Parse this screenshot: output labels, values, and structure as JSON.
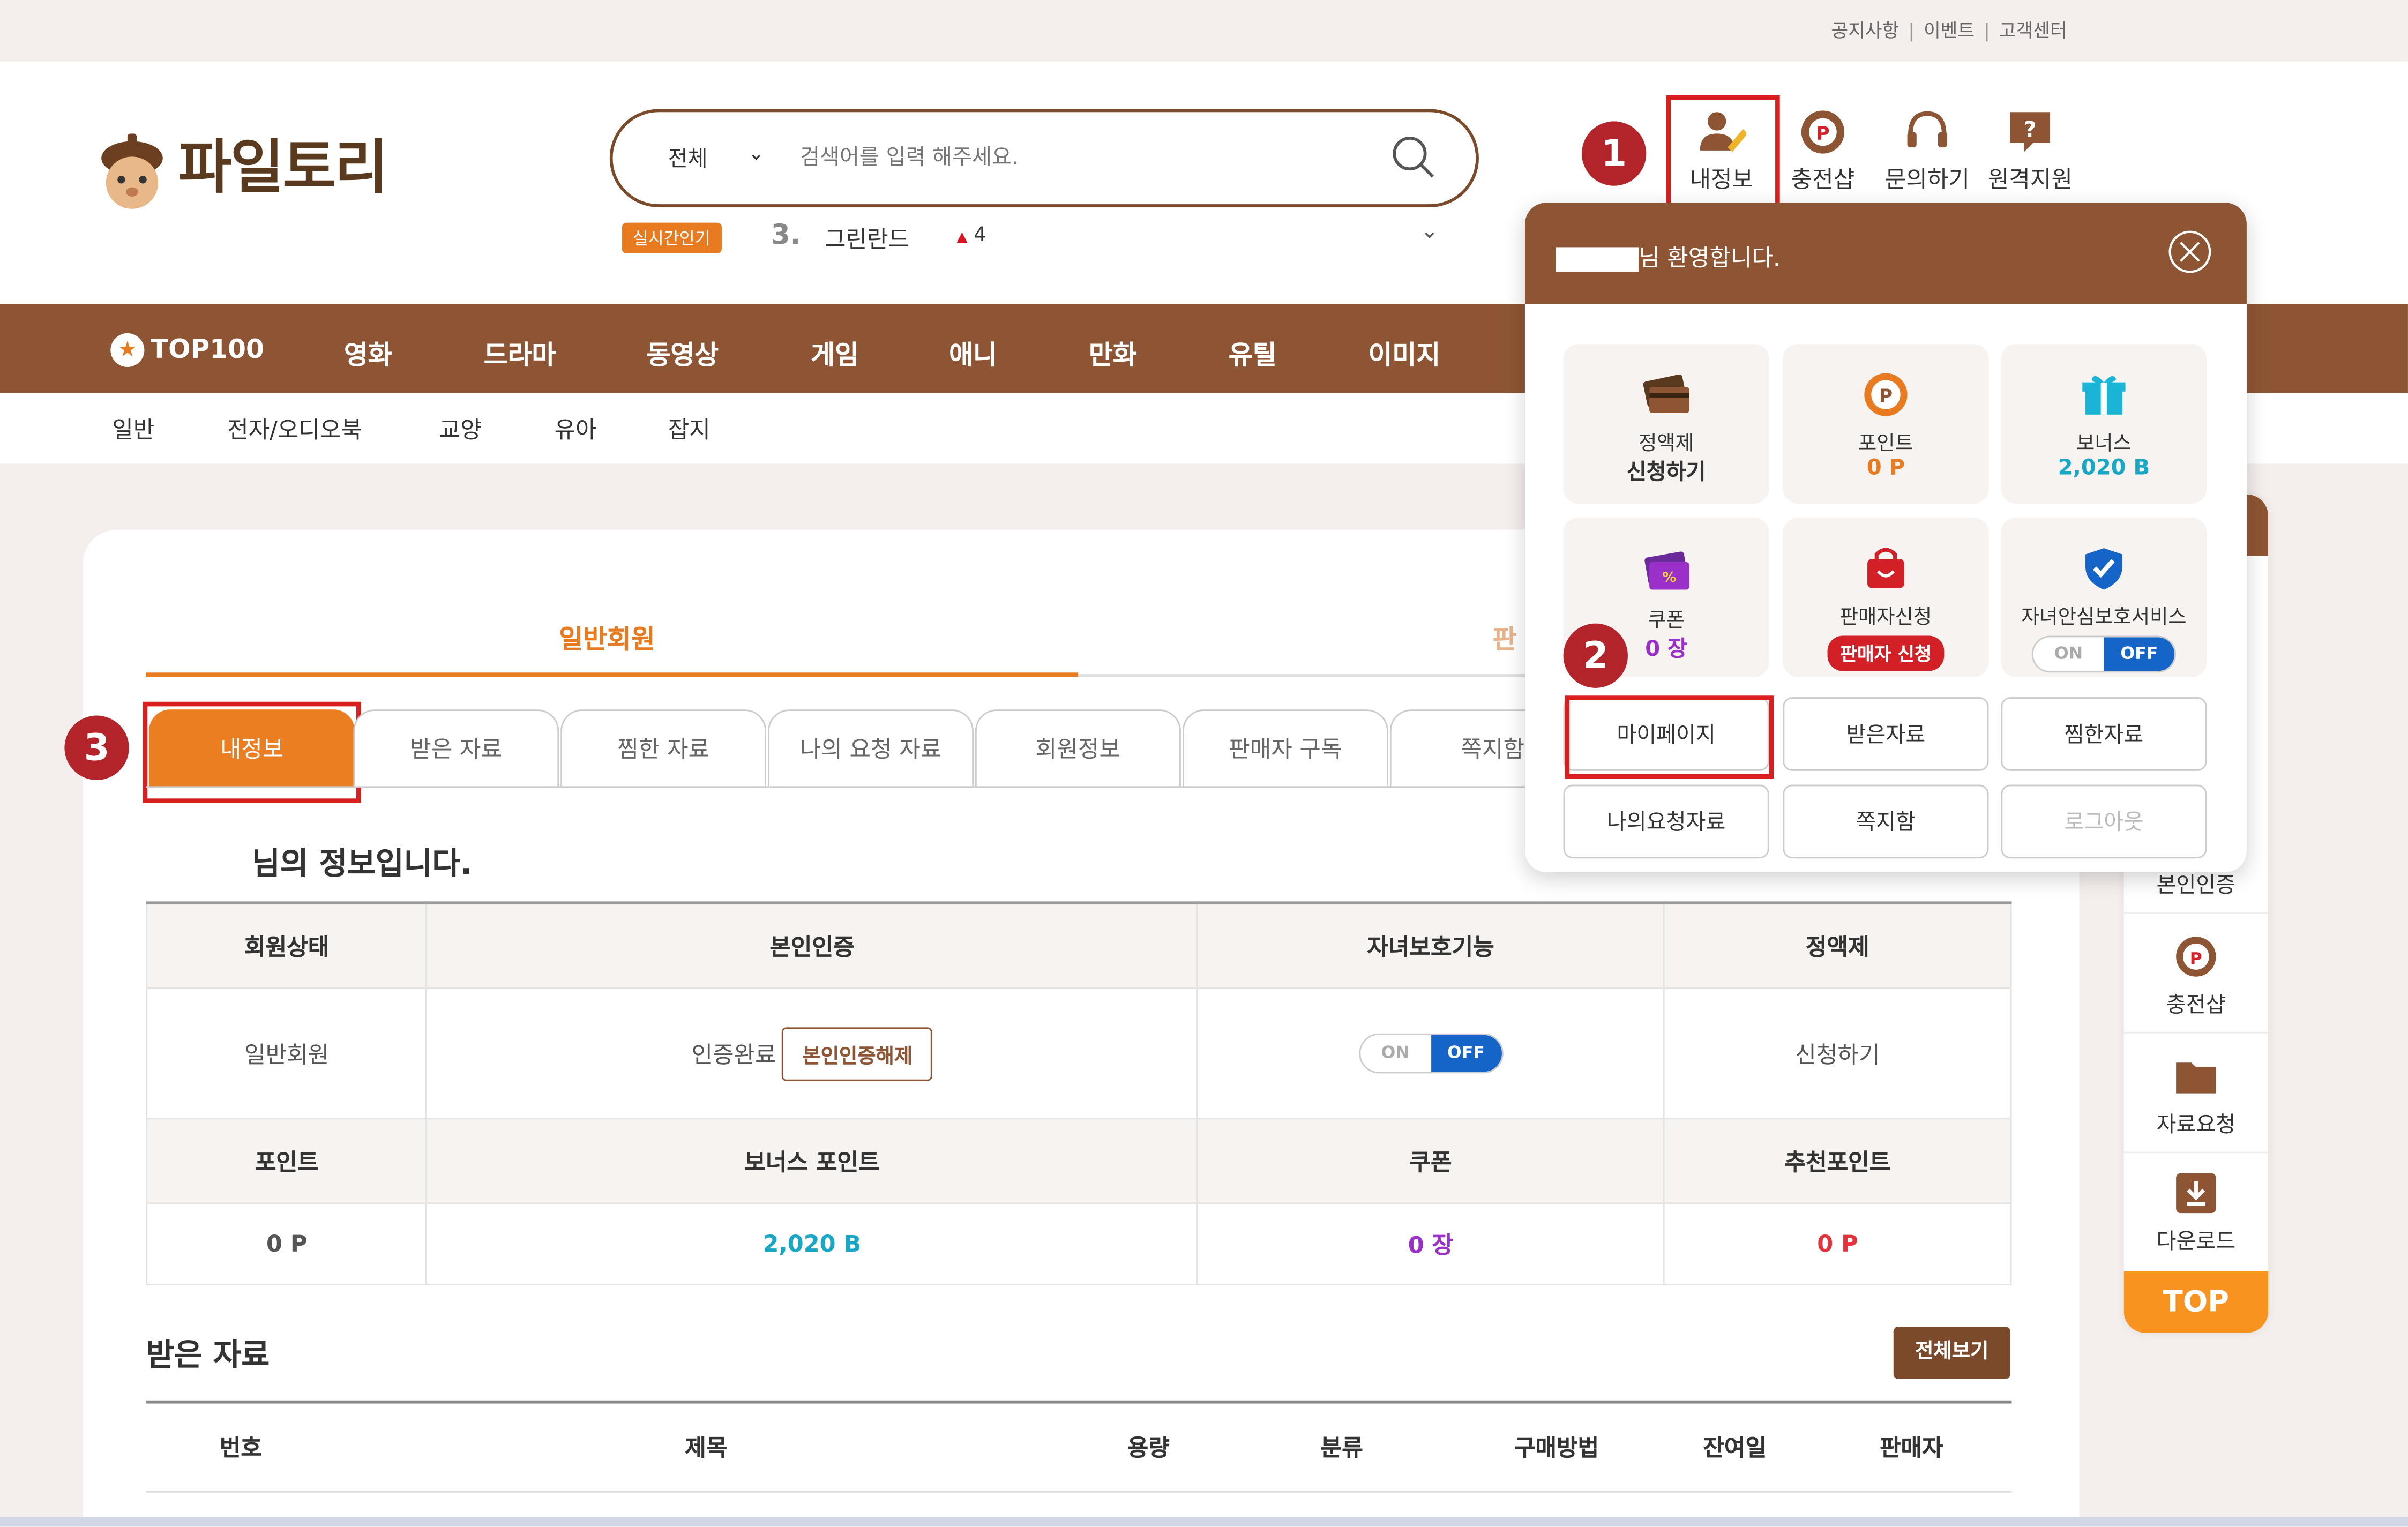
{
  "top_links": [
    "공지사항",
    "이벤트",
    "고객센터"
  ],
  "brand": "파일토리",
  "search": {
    "category": "전체",
    "placeholder": "검색어를 입력 해주세요."
  },
  "realtime": {
    "label": "실시간인기",
    "rank": "3.",
    "keyword": "그린란드",
    "change": "4"
  },
  "header_icons": [
    "내정보",
    "충전샵",
    "문의하기",
    "원격지원"
  ],
  "callouts": [
    "1",
    "2",
    "3"
  ],
  "nav": [
    "TOP100",
    "영화",
    "드라마",
    "동영상",
    "게임",
    "애니",
    "만화",
    "유틸",
    "이미지"
  ],
  "subnav": [
    "일반",
    "전자/오디오북",
    "교양",
    "유아",
    "잡지"
  ],
  "member_tabs": [
    "일반회원",
    "판"
  ],
  "sub_tabs": [
    "내정보",
    "받은 자료",
    "찜한 자료",
    "나의 요청 자료",
    "회원정보",
    "판매자 구독",
    "쪽지함"
  ],
  "info_title": "님의 정보입니다.",
  "info_table": {
    "row1_headers": [
      "회원상태",
      "본인인증",
      "자녀보호기능",
      "정액제"
    ],
    "row1_values": {
      "status": "일반회원",
      "cert_text": "인증완료",
      "cert_btn": "본인인증해제",
      "toggle_on": "ON",
      "toggle_off": "OFF",
      "plan": "신청하기"
    },
    "row2_headers": [
      "포인트",
      "보너스 포인트",
      "쿠폰",
      "추천포인트"
    ],
    "row2_values": [
      "0 P",
      "2,020 B",
      "0 장",
      "0 P"
    ]
  },
  "received": {
    "title": "받은 자료",
    "all_btn": "전체보기",
    "columns": [
      "번호",
      "제목",
      "용량",
      "분류",
      "구매방법",
      "잔여일",
      "판매자"
    ]
  },
  "sidebar": {
    "items": [
      "본인인증",
      "충전샵",
      "자료요청",
      "다운로드"
    ],
    "top": "TOP"
  },
  "dropdown": {
    "welcome": "님 환영합니다.",
    "tiles": {
      "plan": {
        "label": "정액제",
        "value": "신청하기"
      },
      "point": {
        "label": "포인트",
        "value": "0 P"
      },
      "bonus": {
        "label": "보너스",
        "value": "2,020 B"
      },
      "coupon": {
        "label": "쿠폰",
        "value": "0 장"
      },
      "seller": {
        "label": "판매자신청",
        "value": "판매자 신청"
      },
      "child": {
        "label": "자녀안심보호서비스",
        "on": "ON",
        "off": "OFF"
      }
    },
    "buttons": [
      "마이페이지",
      "받은자료",
      "찜한자료",
      "나의요청자료",
      "쪽지함",
      "로그아웃"
    ]
  },
  "colors": {
    "brown": "#8d5533",
    "orange": "#ec7e22",
    "red": "#d7201f",
    "blue": "#1565c8",
    "teal": "#19a7c6",
    "purple": "#9b30c8"
  }
}
